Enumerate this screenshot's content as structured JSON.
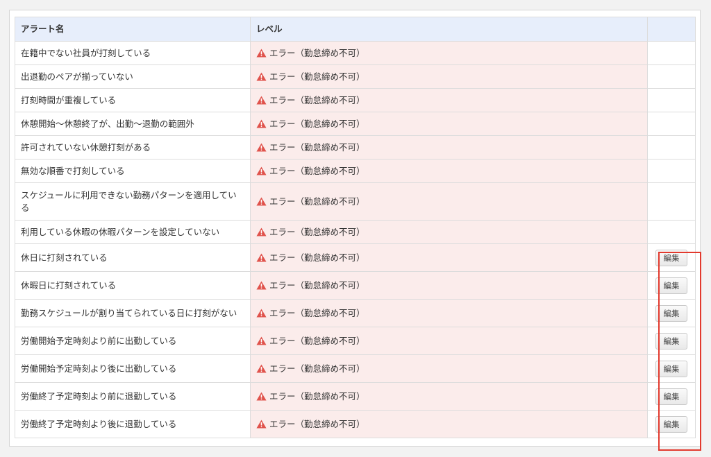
{
  "table": {
    "headers": {
      "name": "アラート名",
      "level": "レベル",
      "action": ""
    },
    "edit_label": "編集",
    "rows": [
      {
        "name": "在籍中でない社員が打刻している",
        "level": "エラー（勤怠締め不可）",
        "editable": false
      },
      {
        "name": "出退勤のペアが揃っていない",
        "level": "エラー（勤怠締め不可）",
        "editable": false
      },
      {
        "name": "打刻時間が重複している",
        "level": "エラー（勤怠締め不可）",
        "editable": false
      },
      {
        "name": "休憩開始〜休憩終了が、出勤〜退勤の範囲外",
        "level": "エラー（勤怠締め不可）",
        "editable": false
      },
      {
        "name": "許可されていない休憩打刻がある",
        "level": "エラー（勤怠締め不可）",
        "editable": false
      },
      {
        "name": "無効な順番で打刻している",
        "level": "エラー（勤怠締め不可）",
        "editable": false
      },
      {
        "name": "スケジュールに利用できない勤務パターンを適用している",
        "level": "エラー（勤怠締め不可）",
        "editable": false
      },
      {
        "name": "利用している休暇の休暇パターンを設定していない",
        "level": "エラー（勤怠締め不可）",
        "editable": false
      },
      {
        "name": "休日に打刻されている",
        "level": "エラー（勤怠締め不可）",
        "editable": true
      },
      {
        "name": "休暇日に打刻されている",
        "level": "エラー（勤怠締め不可）",
        "editable": true
      },
      {
        "name": "勤務スケジュールが割り当てられている日に打刻がない",
        "level": "エラー（勤怠締め不可）",
        "editable": true
      },
      {
        "name": "労働開始予定時刻より前に出勤している",
        "level": "エラー（勤怠締め不可）",
        "editable": true
      },
      {
        "name": "労働開始予定時刻より後に出勤している",
        "level": "エラー（勤怠締め不可）",
        "editable": true
      },
      {
        "name": "労働終了予定時刻より前に退勤している",
        "level": "エラー（勤怠締め不可）",
        "editable": true
      },
      {
        "name": "労働終了予定時刻より後に退勤している",
        "level": "エラー（勤怠締め不可）",
        "editable": true
      }
    ]
  },
  "icons": {
    "level": "warning-triangle-icon"
  },
  "colors": {
    "warning": "#e0524b",
    "level_bg": "#fbeceb",
    "header_bg": "#e7eefb",
    "highlight": "#e23a2e"
  }
}
